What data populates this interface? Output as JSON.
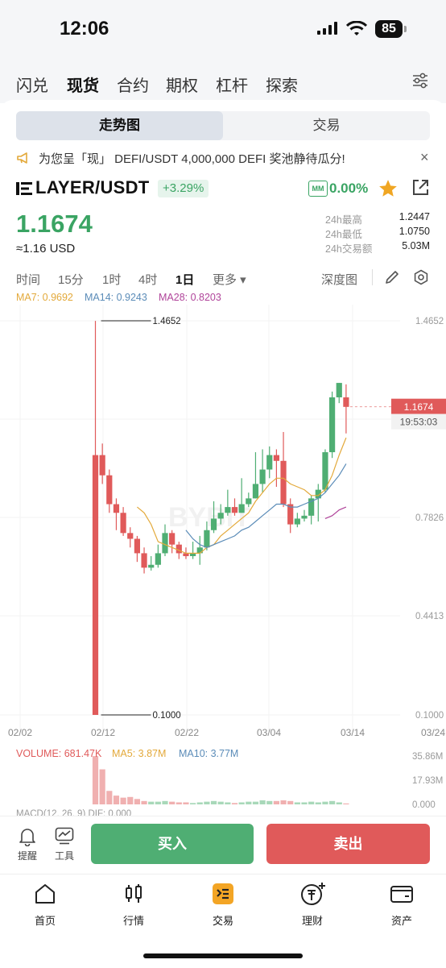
{
  "status": {
    "time": "12:06",
    "battery": "85"
  },
  "top_tabs": [
    "闪兑",
    "现货",
    "合约",
    "期权",
    "杠杆",
    "探索"
  ],
  "active_top_tab": "现货",
  "segment": {
    "chart_label": "走势图",
    "trade_label": "交易"
  },
  "announcement": "为您呈「现」 DEFI/USDT   4,000,000 DEFI 奖池静待瓜分!",
  "pair": {
    "name": "LAYER/USDT",
    "change": "+3.29%",
    "mm_badge": "MM",
    "mm_value": "0.00%"
  },
  "ticker": {
    "price": "1.1674",
    "usd": "≈1.16 USD",
    "stats": [
      {
        "label": "24h最高",
        "value": "1.2447"
      },
      {
        "label": "24h最低",
        "value": "1.0750"
      },
      {
        "label": "24h交易额",
        "value": "5.03M"
      }
    ]
  },
  "intervals": [
    "时间",
    "15分",
    "1时",
    "4时",
    "1日",
    "更多 ▾"
  ],
  "active_interval": "1日",
  "depth_label": "深度图",
  "ma_legend": {
    "ma7": "MA7: 0.9692",
    "ma14": "MA14: 0.9243",
    "ma28": "MA28: 0.8203"
  },
  "colors": {
    "up": "#4fae73",
    "down": "#e05a5a",
    "ma7": "#e3a93a",
    "ma14": "#5b8cb8",
    "ma28": "#b0449a"
  },
  "chart_data": {
    "type": "candlestick",
    "y_ticks": [
      "1.4652",
      "1.1674",
      "0.7826",
      "0.4413",
      "0.1000"
    ],
    "x_ticks": [
      "02/02",
      "02/12",
      "02/22",
      "03/04",
      "03/14",
      "03/24"
    ],
    "high_annotation": "1.4652",
    "low_annotation": "0.1000",
    "last_price_tag": "1.1674",
    "countdown": "19:53:03",
    "watermark": "BYBIT",
    "candles": [
      [
        1.0,
        0.1,
        1.465,
        0.1
      ],
      [
        1.0,
        0.93,
        1.04,
        0.9
      ],
      [
        0.93,
        0.83,
        0.95,
        0.8
      ],
      [
        0.83,
        0.8,
        0.85,
        0.74
      ],
      [
        0.8,
        0.73,
        0.82,
        0.72
      ],
      [
        0.73,
        0.71,
        0.75,
        0.68
      ],
      [
        0.71,
        0.66,
        0.72,
        0.63
      ],
      [
        0.66,
        0.61,
        0.68,
        0.59
      ],
      [
        0.61,
        0.62,
        0.65,
        0.6
      ],
      [
        0.62,
        0.66,
        0.69,
        0.61
      ],
      [
        0.66,
        0.73,
        0.76,
        0.65
      ],
      [
        0.73,
        0.69,
        0.74,
        0.66
      ],
      [
        0.69,
        0.66,
        0.7,
        0.64
      ],
      [
        0.66,
        0.65,
        0.68,
        0.64
      ],
      [
        0.65,
        0.66,
        0.7,
        0.64
      ],
      [
        0.66,
        0.68,
        0.72,
        0.62
      ],
      [
        0.68,
        0.74,
        0.77,
        0.67
      ],
      [
        0.74,
        0.78,
        0.84,
        0.73
      ],
      [
        0.78,
        0.8,
        0.83,
        0.76
      ],
      [
        0.8,
        0.82,
        0.88,
        0.79
      ],
      [
        0.82,
        0.8,
        0.85,
        0.79
      ],
      [
        0.8,
        0.83,
        0.92,
        0.8
      ],
      [
        0.83,
        0.85,
        0.87,
        0.82
      ],
      [
        0.85,
        0.9,
        1.01,
        0.85
      ],
      [
        0.9,
        0.95,
        1.02,
        0.87
      ],
      [
        0.95,
        1.0,
        1.03,
        0.92
      ],
      [
        1.0,
        0.98,
        1.02,
        0.89
      ],
      [
        0.98,
        0.83,
        1.08,
        0.82
      ],
      [
        0.83,
        0.76,
        0.85,
        0.73
      ],
      [
        0.76,
        0.78,
        0.8,
        0.75
      ],
      [
        0.78,
        0.79,
        0.81,
        0.77
      ],
      [
        0.79,
        0.85,
        0.86,
        0.76
      ],
      [
        0.85,
        0.88,
        0.9,
        0.77
      ],
      [
        0.88,
        1.01,
        1.02,
        0.87
      ],
      [
        1.01,
        1.2,
        1.22,
        0.99
      ],
      [
        1.2,
        1.25,
        1.25,
        1.18
      ],
      [
        1.2,
        1.167,
        1.245,
        1.075
      ]
    ],
    "ma_lines": {
      "MA7": [
        null,
        null,
        null,
        null,
        null,
        null,
        0.82,
        0.8,
        0.76,
        0.7,
        0.69,
        0.68,
        0.67,
        0.66,
        0.66,
        0.66,
        0.68,
        0.69,
        0.72,
        0.74,
        0.76,
        0.78,
        0.8,
        0.84,
        0.87,
        0.9,
        0.92,
        0.92,
        0.9,
        0.89,
        0.88,
        0.86,
        0.86,
        0.88,
        0.93,
        1.0,
        1.06
      ],
      "MA14": [
        null,
        null,
        null,
        null,
        null,
        null,
        null,
        null,
        null,
        null,
        null,
        null,
        null,
        0.74,
        0.71,
        0.69,
        0.68,
        0.69,
        0.7,
        0.71,
        0.72,
        0.74,
        0.75,
        0.77,
        0.79,
        0.81,
        0.83,
        0.83,
        0.82,
        0.82,
        0.83,
        0.84,
        0.85,
        0.87,
        0.9,
        0.93,
        0.97
      ],
      "MA28": [
        null,
        null,
        null,
        null,
        null,
        null,
        null,
        null,
        null,
        null,
        null,
        null,
        null,
        null,
        null,
        null,
        null,
        null,
        null,
        null,
        null,
        null,
        null,
        null,
        null,
        null,
        null,
        null,
        null,
        null,
        null,
        null,
        null,
        0.78,
        0.79,
        0.81,
        0.82
      ]
    },
    "volume": {
      "label": "VOLUME: 681.47K",
      "ma5": "MA5: 3.87M",
      "ma10": "MA10: 3.77M",
      "y_ticks": [
        "35.86M",
        "17.93M",
        "0.000"
      ],
      "values": [
        35.8,
        26.0,
        10.0,
        6.5,
        5.0,
        5.5,
        4.0,
        2.5,
        2.0,
        2.0,
        2.5,
        2.0,
        1.5,
        1.5,
        1.0,
        1.5,
        2.0,
        2.5,
        2.0,
        1.5,
        1.0,
        1.5,
        2.0,
        2.0,
        3.0,
        2.5,
        2.5,
        3.0,
        2.5,
        1.5,
        1.5,
        2.0,
        1.5,
        2.0,
        2.5,
        1.5,
        0.7
      ]
    }
  },
  "macd_label": "MACD(12, 26, 9)  DIF: 0.000",
  "tools": [
    {
      "label": "提醒"
    },
    {
      "label": "工具"
    }
  ],
  "buy_label": "买入",
  "sell_label": "卖出",
  "nav": [
    {
      "label": "首页",
      "icon": "home-icon"
    },
    {
      "label": "行情",
      "icon": "candles-icon"
    },
    {
      "label": "交易",
      "icon": "trade-icon"
    },
    {
      "label": "理财",
      "icon": "earn-icon"
    },
    {
      "label": "资产",
      "icon": "wallet-icon"
    }
  ]
}
